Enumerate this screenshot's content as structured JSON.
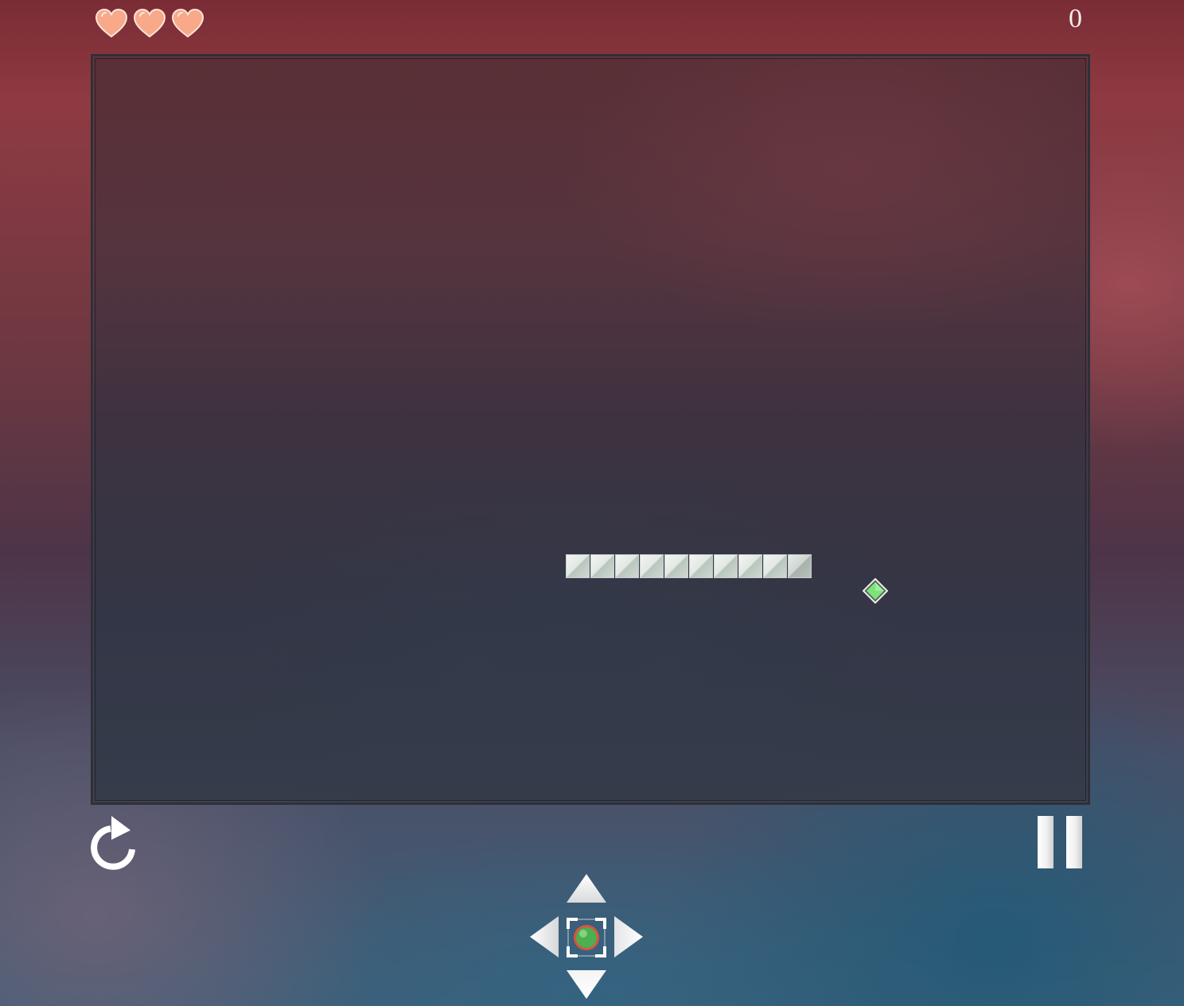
{
  "hud": {
    "lives": 3,
    "lives_max": 3,
    "score": "0",
    "heart_icon": "heart-icon",
    "heart_color": "#f7a98a"
  },
  "game": {
    "grid_unit": "cell",
    "snake": {
      "length": 10,
      "direction": "right",
      "body_color": "#e6ebe8",
      "head_color": "#b9c2bd"
    },
    "food": {
      "icon": "green-diamond-icon",
      "color": "#7ee27a"
    }
  },
  "controls": {
    "restart_icon": "restart-icon",
    "pause_icon": "pause-icon",
    "dpad": {
      "up_icon": "arrow-up-icon",
      "down_icon": "arrow-down-icon",
      "left_icon": "arrow-left-icon",
      "right_icon": "arrow-right-icon",
      "center_icon": "center-target-icon",
      "center_color": "#4caf50"
    }
  }
}
